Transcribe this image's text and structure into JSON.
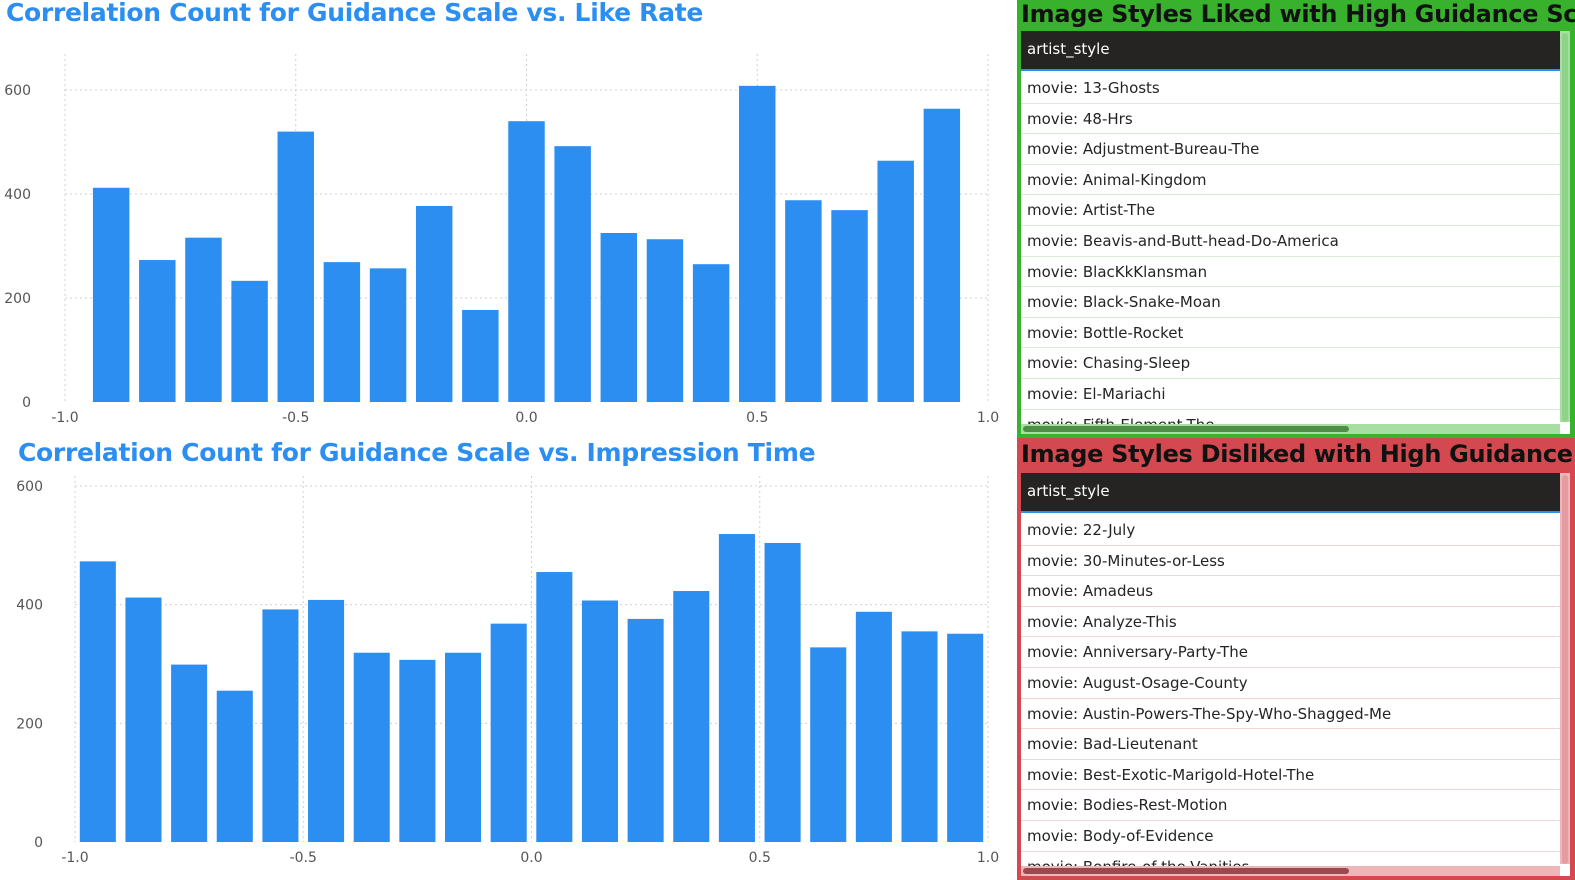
{
  "charts": {
    "like_rate": {
      "title": "Correlation Count for Guidance Scale vs. Like Rate"
    },
    "impression_time": {
      "title": "Correlation Count for Guidance Scale vs. Impression Time"
    }
  },
  "chart_data": [
    {
      "type": "bar",
      "title": "Correlation Count for Guidance Scale vs. Like Rate",
      "xlabel": "",
      "ylabel": "",
      "x": [
        -0.9,
        -0.8,
        -0.7,
        -0.6,
        -0.5,
        -0.4,
        -0.3,
        -0.2,
        -0.1,
        0.0,
        0.1,
        0.2,
        0.3,
        0.4,
        0.5,
        0.6,
        0.7,
        0.8,
        0.9
      ],
      "values": [
        412,
        273,
        316,
        233,
        520,
        269,
        257,
        377,
        177,
        540,
        492,
        325,
        313,
        265,
        608,
        388,
        369,
        464,
        564
      ],
      "xlim": [
        -1.0,
        1.0
      ],
      "ylim": [
        0,
        650
      ],
      "xticks": [
        "-1.0",
        "-0.5",
        "0.0",
        "0.5",
        "1.0"
      ],
      "yticks": [
        "0",
        "200",
        "400",
        "600"
      ],
      "grid": true
    },
    {
      "type": "bar",
      "title": "Correlation Count for Guidance Scale vs. Impression Time",
      "xlabel": "",
      "ylabel": "",
      "x": [
        -0.95,
        -0.85,
        -0.75,
        -0.65,
        -0.55,
        -0.45,
        -0.35,
        -0.25,
        -0.15,
        -0.05,
        0.05,
        0.15,
        0.25,
        0.35,
        0.45,
        0.55,
        0.65,
        0.75,
        0.85,
        0.95
      ],
      "values": [
        473,
        412,
        299,
        255,
        392,
        408,
        319,
        307,
        319,
        368,
        455,
        407,
        376,
        423,
        519,
        504,
        328,
        388,
        355,
        351
      ],
      "xlim": [
        -1.0,
        1.0
      ],
      "ylim": [
        0,
        600
      ],
      "xticks": [
        "-1.0",
        "-0.5",
        "0.0",
        "0.5",
        "1.0"
      ],
      "yticks": [
        "0",
        "200",
        "400",
        "600"
      ],
      "grid": true
    }
  ],
  "liked_panel": {
    "title": "Image Styles Liked with High Guidance Scale",
    "column_header": "artist_style",
    "accent_color": "#38b22c",
    "rows": [
      "movie: 13-Ghosts",
      "movie: 48-Hrs",
      "movie: Adjustment-Bureau-The",
      "movie: Animal-Kingdom",
      "movie: Artist-The",
      "movie: Beavis-and-Butt-head-Do-America",
      "movie: BlacKkKlansman",
      "movie: Black-Snake-Moan",
      "movie: Bottle-Rocket",
      "movie: Chasing-Sleep",
      "movie: El-Mariachi",
      "movie: Fifth-Element-The"
    ]
  },
  "disliked_panel": {
    "title": "Image Styles Disliked with High Guidance Scale",
    "column_header": "artist_style",
    "accent_color": "#d4484f",
    "rows": [
      "movie: 22-July",
      "movie: 30-Minutes-or-Less",
      "movie: Amadeus",
      "movie: Analyze-This",
      "movie: Anniversary-Party-The",
      "movie: August-Osage-County",
      "movie: Austin-Powers-The-Spy-Who-Shagged-Me",
      "movie: Bad-Lieutenant",
      "movie: Best-Exotic-Marigold-Hotel-The",
      "movie: Bodies-Rest-Motion",
      "movie: Body-of-Evidence",
      "movie: Bonfire-of-the-Vanities"
    ]
  },
  "colors": {
    "bar": "#2b8ef0",
    "title": "#2b8ef0",
    "table_header_bg": "#252423"
  }
}
